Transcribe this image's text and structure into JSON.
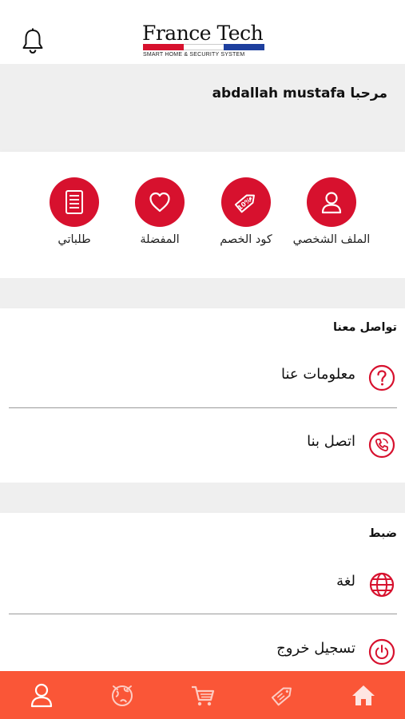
{
  "header": {
    "logo_title": "France Tech",
    "logo_subtitle": "SMART HOME & SECURITY SYSTEM",
    "icons": [
      "bell-icon"
    ]
  },
  "greeting": "مرحبا abdallah mustafa",
  "quick_actions": [
    {
      "label": "الملف الشخصي",
      "icon": "user-icon"
    },
    {
      "label": "كود الخصم",
      "icon": "discount-tag-icon"
    },
    {
      "label": "المفضلة",
      "icon": "heart-icon"
    },
    {
      "label": "طلباتي",
      "icon": "orders-list-icon"
    }
  ],
  "contact": {
    "title": "تواصل معنا",
    "items": [
      {
        "label": "معلومات عنا",
        "icon": "question-icon"
      },
      {
        "label": "اتصل بنا",
        "icon": "phone-icon"
      }
    ]
  },
  "settings": {
    "title": "ضبط",
    "items": [
      {
        "label": "لغة",
        "icon": "globe-icon"
      },
      {
        "label": "تسجيل خروج",
        "icon": "power-icon"
      }
    ]
  },
  "tabbar": {
    "tabs": [
      "profile-tab-icon",
      "world-tab-icon",
      "cart-tab-icon",
      "tag-tab-icon",
      "home-tab-icon"
    ]
  },
  "colors": {
    "accent_red": "#d7112e",
    "tabbar_orange": "#fa5637",
    "band_gray": "#efefef",
    "logo_blue": "#1d3f9e"
  }
}
